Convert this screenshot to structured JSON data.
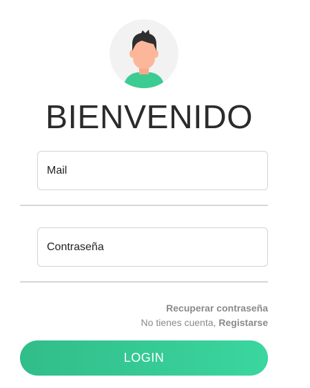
{
  "colors": {
    "accent_start": "#31bd8a",
    "accent_end": "#3bd69f",
    "avatar_bg": "#f2f2f2",
    "avatar_skin": "#fcb79a",
    "avatar_hair": "#2e2e2e",
    "avatar_shirt": "#3ccb91"
  },
  "avatar": {
    "icon": "user-avatar-icon"
  },
  "header": {
    "title": "BIENVENIDO"
  },
  "form": {
    "mail_placeholder": "Mail",
    "password_placeholder": "Contraseña"
  },
  "links": {
    "recover_label": "Recuperar contraseña",
    "no_account_text": "No tienes cuenta, ",
    "register_label": "Registarse"
  },
  "actions": {
    "login_label": "LOGIN"
  }
}
